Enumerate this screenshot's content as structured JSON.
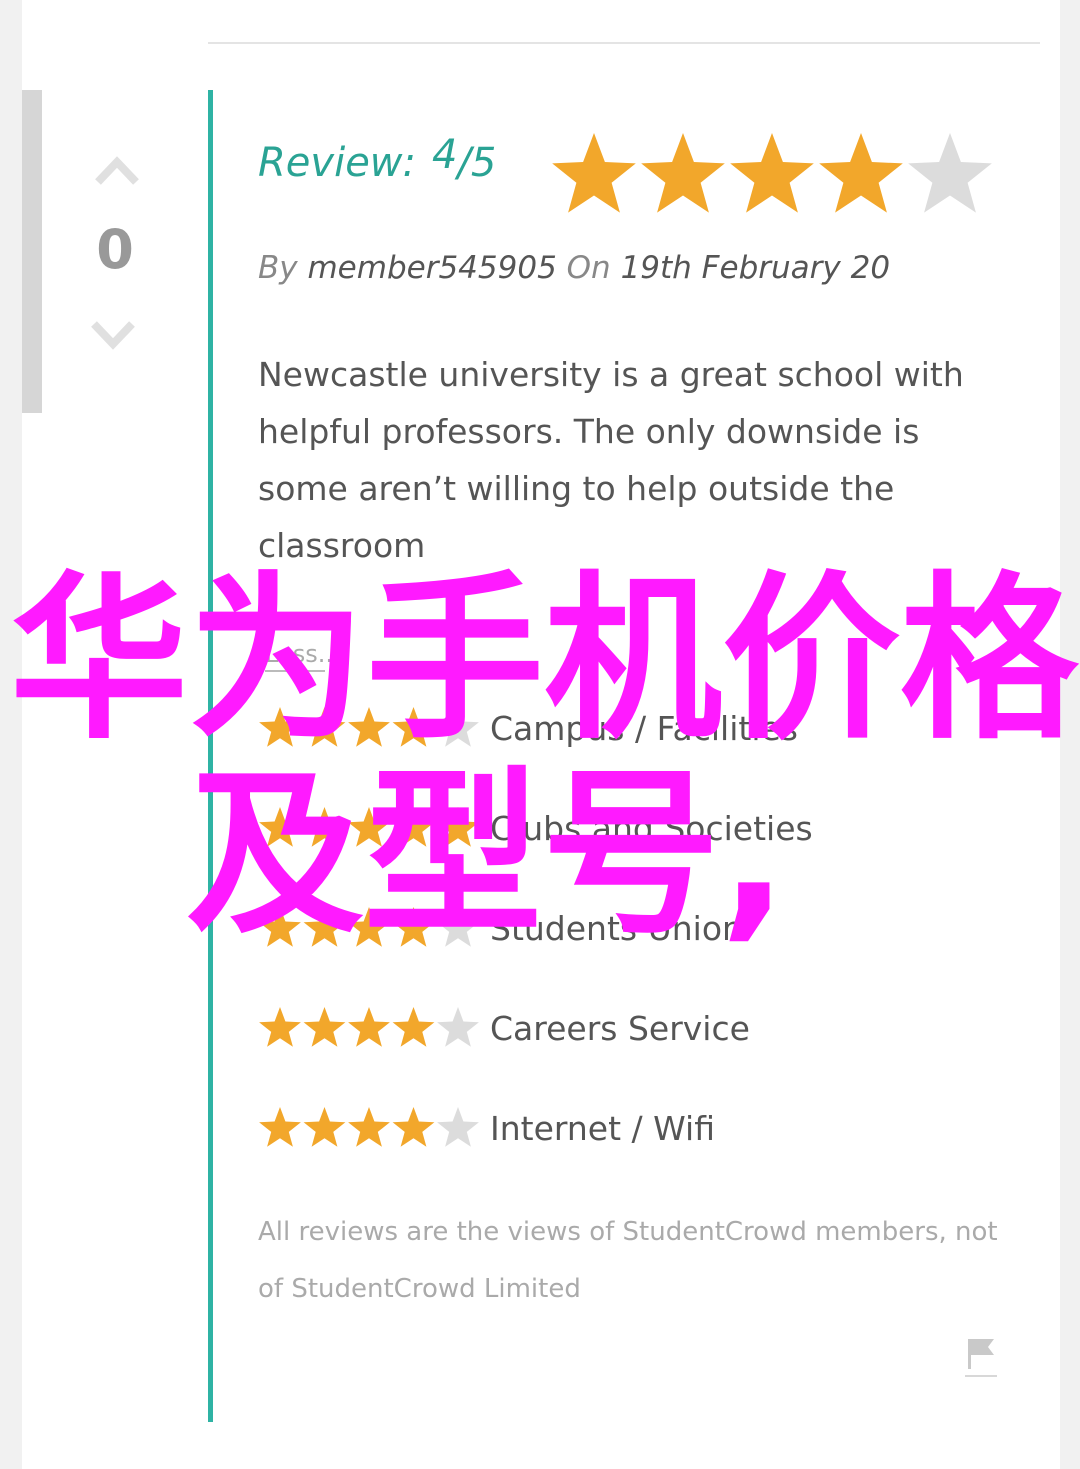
{
  "vote": {
    "count": "0"
  },
  "review": {
    "label": "Review:",
    "score": "4",
    "max": "/5",
    "stars": 4,
    "by_prefix": "By",
    "author": "member545905",
    "on_prefix": "On",
    "date": "19th February 20",
    "text": "Newcastle university is a great school with helpful professors. The only downside is some aren’t willing to help outside the classroom",
    "less_link": "Less..."
  },
  "categories": [
    {
      "label": "Campus / Facilities",
      "stars": 4
    },
    {
      "label": "Clubs and Societies",
      "stars": 5
    },
    {
      "label": "Students Union",
      "stars": 4
    },
    {
      "label": "Careers Service",
      "stars": 4
    },
    {
      "label": "Internet / Wifi",
      "stars": 4
    }
  ],
  "disclaimer": "All reviews are the views of StudentCrowd members, not of StudentCrowd Limited",
  "overlay": {
    "line1": "华为手机价格",
    "line2": "及型号,"
  },
  "colors": {
    "accent": "#2fb3a4",
    "star_on": "#f2a72b",
    "star_off": "#dcdcdc",
    "overlay": "#ff1aff"
  },
  "icons": {
    "up": "chevron-up-icon",
    "down": "chevron-down-icon",
    "flag": "flag-icon",
    "star": "star-icon"
  }
}
